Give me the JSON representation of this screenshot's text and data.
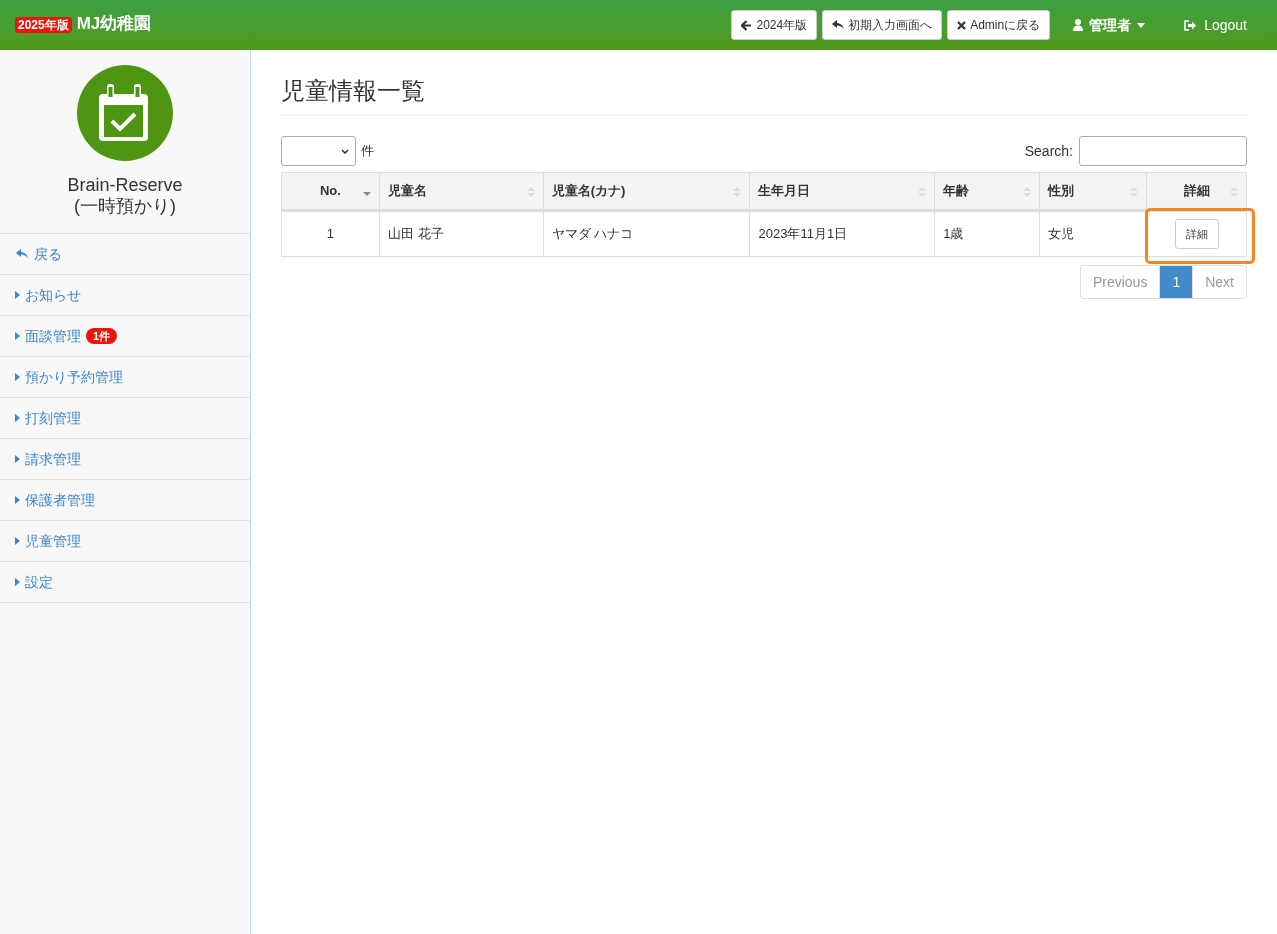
{
  "header": {
    "badge": "2025年版",
    "brand": "MJ幼稚園",
    "buttons": [
      {
        "kind": "back",
        "label": "2024年版"
      },
      {
        "kind": "return",
        "label": "初期入力画面へ"
      },
      {
        "kind": "close",
        "label": "Adminに戻る"
      }
    ],
    "user": "管理者",
    "logout": "Logout"
  },
  "sidebar": {
    "title": "Brain-Reserve",
    "subtitle": "(一時預かり)",
    "items": [
      {
        "kind": "back",
        "label": "戻る"
      },
      {
        "kind": "menu",
        "label": "お知らせ"
      },
      {
        "kind": "menu",
        "label": "面談管理",
        "badge": "1件"
      },
      {
        "kind": "menu",
        "label": "預かり予約管理"
      },
      {
        "kind": "menu",
        "label": "打刻管理"
      },
      {
        "kind": "menu",
        "label": "請求管理"
      },
      {
        "kind": "menu",
        "label": "保護者管理"
      },
      {
        "kind": "menu",
        "label": "児童管理"
      },
      {
        "kind": "menu",
        "label": "設定"
      }
    ]
  },
  "page_title": "児童情報一覧",
  "length_label": "件",
  "search_label": "Search:",
  "table": {
    "columns": [
      {
        "label": "No.",
        "sorted": true
      },
      {
        "label": "児童名",
        "sorted": false
      },
      {
        "label": "児童名(カナ)",
        "sorted": false
      },
      {
        "label": "生年月日",
        "sorted": false
      },
      {
        "label": "年齢",
        "sorted": false
      },
      {
        "label": "性別",
        "sorted": false
      },
      {
        "label": "詳細",
        "sorted": false
      }
    ],
    "rows": [
      {
        "cells": [
          "1",
          "山田 花子",
          "ヤマダ ハナコ",
          "2023年11月1日",
          "1歳",
          "女児"
        ],
        "button": "詳細",
        "highlighted": true
      }
    ]
  },
  "pagination": {
    "previous": "Previous",
    "pages": [
      {
        "label": "1",
        "selected": true
      }
    ],
    "next": "Next"
  }
}
